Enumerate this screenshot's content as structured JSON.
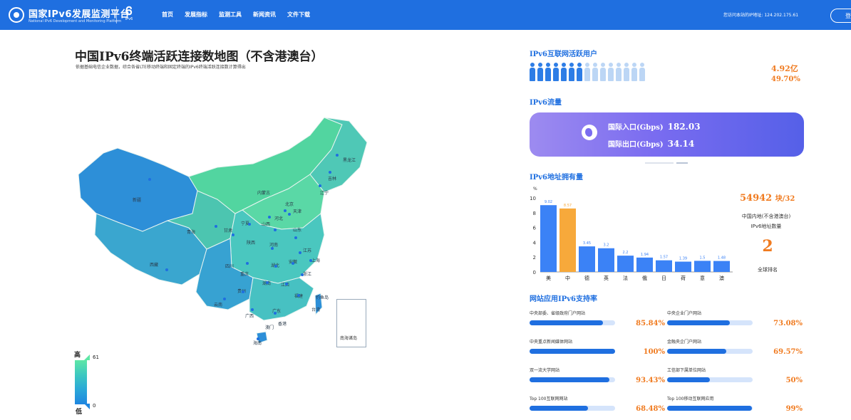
{
  "header": {
    "title": "国家IPv6发展监测平台",
    "subtitle": "National IPv6 Development and Monitoring Platform",
    "logo_text": "IPv6",
    "nav": [
      "首页",
      "发展指标",
      "监测工具",
      "新闻资讯",
      "文件下载"
    ],
    "ip_info": "您访问本站的IP地址: 124.202.175.61"
  },
  "map": {
    "title": "中国IPv6终端活跃连接数地图（不含港澳台）",
    "subtitle": "依据基础电信企业数据，综合各省LTE移动终端和固定终端的IPv6终端活跃连接数计算得出",
    "province_labels": [
      "新疆",
      "西藏",
      "青海",
      "甘肃",
      "内蒙古",
      "黑龙江",
      "吉林",
      "辽宁",
      "北京",
      "天津",
      "河北",
      "山西",
      "陕西",
      "宁夏",
      "山东",
      "河南",
      "江苏",
      "上海",
      "安徽",
      "湖北",
      "四川",
      "重庆",
      "浙江",
      "江西",
      "湖南",
      "贵州",
      "云南",
      "福建",
      "台湾",
      "广西",
      "广东",
      "香港",
      "澳门",
      "海南",
      "钓鱼岛",
      "南海诸岛"
    ],
    "legend": {
      "high": "高",
      "low": "低",
      "max": "61",
      "min": "0"
    }
  },
  "active_users": {
    "title": "IPv6互联网活跃用户",
    "value": "4.92亿",
    "percent": "49.70%",
    "ratio": 0.497
  },
  "traffic": {
    "title": "IPv6流量",
    "inbound_label": "国际入口(Gbps)",
    "inbound_value": "182.03",
    "outbound_label": "国际出口(Gbps)",
    "outbound_value": "34.14"
  },
  "address": {
    "title": "IPv6地址拥有量",
    "count": "54942",
    "count_unit": "块/32",
    "desc_line1": "中国内地(不含港澳台)",
    "desc_line2": "IPv6地址数量",
    "rank": "2",
    "rank_label": "全球排名"
  },
  "chart_data": {
    "type": "bar",
    "categories": [
      "美",
      "中",
      "德",
      "英",
      "法",
      "俄",
      "日",
      "荷",
      "意",
      "澳"
    ],
    "values": [
      9.02,
      8.57,
      3.45,
      3.2,
      2.2,
      1.94,
      1.57,
      1.39,
      1.5,
      1.48
    ],
    "data_labels": [
      "9.02",
      "8.57",
      "3.45",
      "3.2",
      "2.2",
      "1.94",
      "1.57",
      "1.39",
      "1.5",
      "1.48"
    ],
    "y_ticks": [
      "0",
      "2",
      "4",
      "6",
      "8",
      "10"
    ],
    "ylabel": "%",
    "ylim": [
      0,
      10
    ],
    "highlight_index": 1,
    "colors": {
      "bar": "#3b82f6",
      "highlight": "#f7a93b"
    }
  },
  "support": {
    "title": "网站应用IPv6支持率",
    "items": [
      {
        "label": "中央部委、省级政府门户网站",
        "percent": "85.84%",
        "value": 0.8584
      },
      {
        "label": "中央企业门户网站",
        "percent": "73.08%",
        "value": 0.7308
      },
      {
        "label": "中央重点新闻媒体网站",
        "percent": "100%",
        "value": 1.0
      },
      {
        "label": "金融央企门户网站",
        "percent": "69.57%",
        "value": 0.6957
      },
      {
        "label": "双一流大学网站",
        "percent": "93.43%",
        "value": 0.9343
      },
      {
        "label": "工信部下属单位网站",
        "percent": "50%",
        "value": 0.5
      },
      {
        "label": "Top 100互联网网站",
        "percent": "68.48%",
        "value": 0.6848
      },
      {
        "label": "Top 100移动互联网应用",
        "percent": "99%",
        "value": 0.99
      }
    ]
  }
}
